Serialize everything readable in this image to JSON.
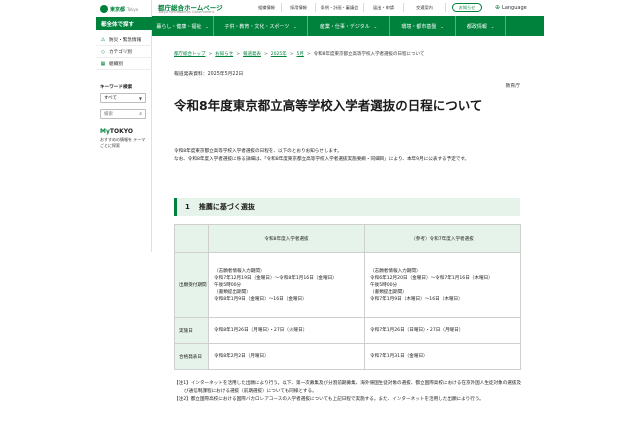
{
  "sidebar": {
    "logo_text": "東京都",
    "logo_en": "Tokyo",
    "heading": "都全体で探す",
    "items": [
      {
        "icon": "warning-icon",
        "label": "防災・緊急情報"
      },
      {
        "icon": "tag-icon",
        "label": "カテゴリ別"
      },
      {
        "icon": "building-icon",
        "label": "組織別"
      }
    ],
    "keyword_label": "キーワード検索",
    "select_value": "すべて",
    "search_placeholder": "検索",
    "mytokyo": {
      "logo_my": "My",
      "logo_tokyo": "TOKYO",
      "desc": "おすすめの情報を テーマごとに探索"
    }
  },
  "header": {
    "site_title": "都庁総合ホームページ",
    "site_sub": "Tokyo Metropolitan Government",
    "utils": [
      "組織情報",
      "採用情報",
      "条例・計画・審議会",
      "届出・申請",
      "交通案内"
    ],
    "notice": "お知らせ",
    "language": "Language"
  },
  "gnav": [
    "暮らし・健康・福祉",
    "子供・教育・文化・スポーツ",
    "産業・仕事・デジタル",
    "環境・都市基盤",
    "都政情報"
  ],
  "breadcrumb": [
    "都庁総合トップ",
    "お知らせ",
    "報道発表",
    "2025年",
    "5月",
    "令和8年度東京都立高等学校入学者選抜の日程について"
  ],
  "release_date": "報道発表資料：2025年5月22日",
  "department": "教育庁",
  "title": "令和8年度東京都立高等学校入学者選抜の日程について",
  "intro": [
    "令和8年度東京都立高等学校入学者選抜の日程を、以下のとおりお知らせします。",
    "なお、令和8年度入学者選抜に係る詳細は、「令和8年度東京都立高等学校入学者選抜実施要綱・同細目」により、本年9月に公表する予定です。"
  ],
  "section": {
    "number": "1",
    "title": "推薦に基づく選抜"
  },
  "table": {
    "col_a": "令和8年度入学者選抜",
    "col_b": "（参考）令和7年度入学者選抜",
    "rows": {
      "apply": {
        "label": "出願受付期間",
        "a": [
          "（志願者情報入力期間）",
          "令和7年12月19日（金曜日）〜令和8年1月16日（金曜日）",
          "午後5時00分",
          "（書類提出期間）",
          "令和8年1月9日（金曜日）〜16日（金曜日）"
        ],
        "b": [
          "（志願者情報入力期間）",
          "令和6年12月20日（金曜日）〜令和7年1月16日（木曜日）",
          "午後5時00分",
          "（書類提出期間）",
          "令和7年1月9日（木曜日）〜16日（木曜日）"
        ]
      },
      "exam": {
        "label": "実施日",
        "a": "令和8年1月26日（月曜日）・27日（火曜日）",
        "b": "令和7年1月26日（日曜日）・27日（月曜日）"
      },
      "result": {
        "label": "合格発表日",
        "a": "令和8年2月2日（月曜日）",
        "b": "令和7年1月31日（金曜日）"
      }
    }
  },
  "notes": [
    "【注1】インターネットを活用した出願により行う。以下、第一次募集及び分割前期募集、海外帰国生徒対象の選抜、都立国際高校における在京外国人生徒対象の選抜及び通信制課程における選抜（前期選抜）についても同様とする。",
    "【注2】都立国際高校における国際バカロレアコースの入学者選抜についても上記日程で実施する。また、インターネットを活用した出願により行う。"
  ],
  "colors": {
    "brand_green": "#00813c",
    "light_green": "#e6f3ea"
  }
}
